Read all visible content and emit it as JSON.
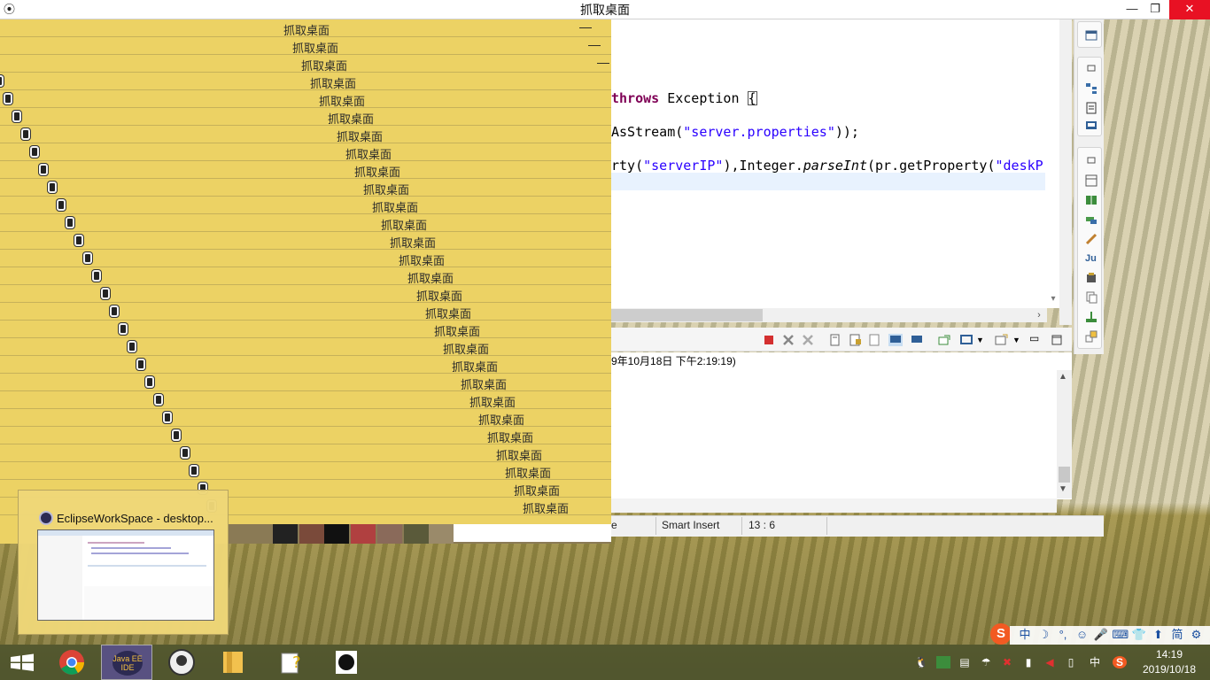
{
  "window": {
    "title": "抓取桌面",
    "minimize": "—",
    "maximize": "❐",
    "close": "✕"
  },
  "editor": {
    "lines": [
      {
        "kind": "throws",
        "kw": "throws",
        "rest": " Exception ",
        "bracket": "{"
      },
      {
        "kind": "stream",
        "pre": "AsStream(",
        "str": "\"server.properties\"",
        "post": "));"
      },
      {
        "kind": "prop",
        "pre": "rty(",
        "str1": "\"serverIP\"",
        "mid1": "),Integer.",
        "method": "parseInt",
        "mid2": "(pr.getProperty(",
        "str2": "\"deskP"
      }
    ]
  },
  "console": {
    "header": "9年10月18日 下午2:19:19)"
  },
  "status": {
    "insert_mode": "Smart Insert",
    "position": "13 : 6",
    "left_cut": "e"
  },
  "cascade": {
    "title": "抓取桌面",
    "dash": "—",
    "rows": 28
  },
  "preview": {
    "title": "EclipseWorkSpace - desktop..."
  },
  "taskbar": {
    "apps": [
      "windows-start",
      "chrome",
      "java-ee-ide",
      "app-circle",
      "file-explorer",
      "help-document",
      "che-guevara-app"
    ],
    "java_ee_label": "Java EE IDE"
  },
  "ime": {
    "items": [
      "中",
      "☽",
      "°,",
      "☺",
      "🎤",
      "⌨",
      "👕",
      "⬆",
      "简",
      "⚙"
    ]
  },
  "tray": {
    "clock_time": "14:19",
    "clock_date": "2019/10/18",
    "lang": "中"
  },
  "colors": {
    "yellow": "#ecd264",
    "keyword": "#7f0055",
    "string": "#2a00ff",
    "close_red": "#e81123",
    "sogou": "#f25a22"
  }
}
